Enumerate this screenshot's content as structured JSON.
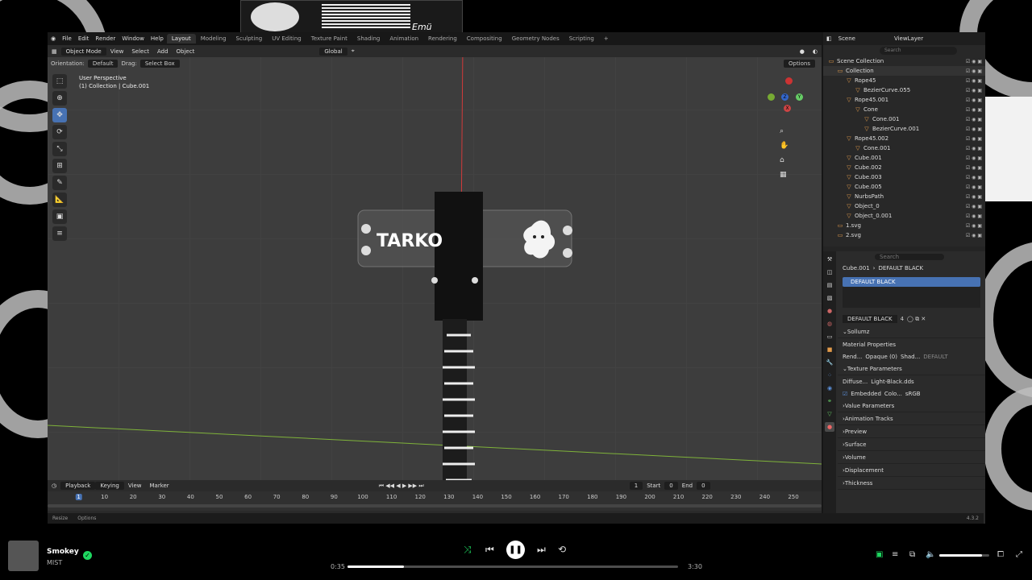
{
  "background_thumb": {
    "text": "Emü"
  },
  "blender": {
    "menu": [
      "File",
      "Edit",
      "Render",
      "Window",
      "Help"
    ],
    "workspaces": [
      "Layout",
      "Modeling",
      "Sculpting",
      "UV Editing",
      "Texture Paint",
      "Shading",
      "Animation",
      "Rendering",
      "Compositing",
      "Geometry Nodes",
      "Scripting"
    ],
    "active_workspace": "Layout",
    "header": {
      "mode": "Object Mode",
      "view": "View",
      "select": "Select",
      "add": "Add",
      "object": "Object",
      "transform": "Global",
      "options": "Options"
    },
    "header2": {
      "orientation_label": "Orientation:",
      "orientation": "Default",
      "drag_label": "Drag:",
      "drag": "Select Box"
    },
    "viewport": {
      "perspective": "User Perspective",
      "collection": "(1) Collection | Cube.001",
      "model_text": "TARKO"
    },
    "outliner": {
      "scene": "Scene",
      "view_layer": "ViewLayer",
      "search_placeholder": "Search",
      "rows": [
        {
          "label": "Scene Collection",
          "indent": 0
        },
        {
          "label": "Collection",
          "indent": 1
        },
        {
          "label": "Rope45",
          "indent": 2
        },
        {
          "label": "BezierCurve.055",
          "indent": 3
        },
        {
          "label": "Rope45.001",
          "indent": 2
        },
        {
          "label": "Cone",
          "indent": 3
        },
        {
          "label": "Cone.001",
          "indent": 4
        },
        {
          "label": "BezierCurve.001",
          "indent": 4
        },
        {
          "label": "Rope45.002",
          "indent": 2
        },
        {
          "label": "Cone.001",
          "indent": 3
        },
        {
          "label": "Cube.001",
          "indent": 2
        },
        {
          "label": "Cube.002",
          "indent": 2
        },
        {
          "label": "Cube.003",
          "indent": 2
        },
        {
          "label": "Cube.005",
          "indent": 2
        },
        {
          "label": "NurbsPath",
          "indent": 2
        },
        {
          "label": "Object_0",
          "indent": 2
        },
        {
          "label": "Object_0.001",
          "indent": 2
        },
        {
          "label": "1.svg",
          "indent": 1
        },
        {
          "label": "2.svg",
          "indent": 1
        }
      ]
    },
    "properties": {
      "search_placeholder": "Search",
      "object": "Cube.001",
      "material": "DEFAULT BLACK",
      "slot": "DEFAULT BLACK",
      "slot_count": "4",
      "sollumz": "Sollumz",
      "mat_props": "Material Properties",
      "render_label": "Rend...",
      "render_value": "Opaque (0)",
      "shader_label": "Shad...",
      "shader_value": "DEFAULT",
      "texture_params": "Texture Parameters",
      "diffuse_label": "Diffuse...",
      "diffuse_value": "Light-Black.dds",
      "embedded": "Embedded",
      "color_label": "Colo...",
      "color_value": "sRGB",
      "value_params": "Value Parameters",
      "anim_tracks": "Animation Tracks",
      "sections": [
        "Preview",
        "Surface",
        "Volume",
        "Displacement",
        "Thickness"
      ]
    },
    "timeline": {
      "playback": "Playback",
      "keying": "Keying",
      "view": "View",
      "marker": "Marker",
      "current": "1",
      "start_label": "Start",
      "start": "0",
      "end_label": "End",
      "end": "0",
      "ticks": [
        "1",
        "10",
        "20",
        "30",
        "40",
        "50",
        "60",
        "70",
        "80",
        "90",
        "100",
        "110",
        "120",
        "130",
        "140",
        "150",
        "160",
        "170",
        "180",
        "190",
        "200",
        "210",
        "220",
        "230",
        "240",
        "250"
      ]
    },
    "status": {
      "resize": "Resize",
      "options": "Options",
      "version": "4.3.2"
    }
  },
  "player": {
    "title": "Smokey",
    "artist": "MIST",
    "elapsed": "0:35",
    "duration": "3:30",
    "progress": 0.17,
    "volume": 0.85
  }
}
